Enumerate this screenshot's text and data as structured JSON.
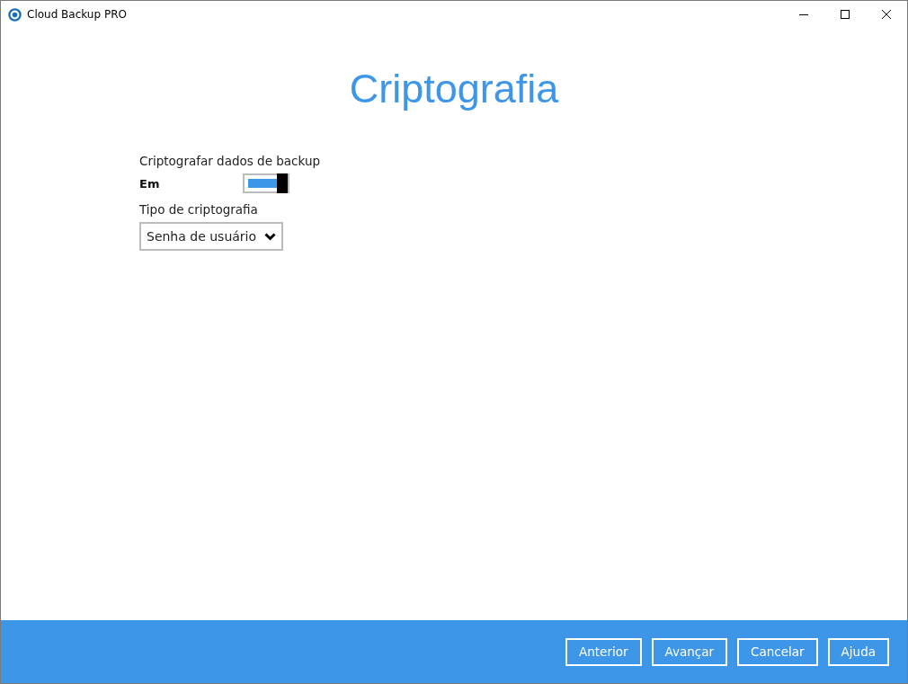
{
  "window": {
    "title": "Cloud Backup PRO"
  },
  "page": {
    "heading": "Criptografia"
  },
  "encrypt": {
    "label": "Criptografar dados de backup",
    "state_text": "Em",
    "on": true
  },
  "encryption_type": {
    "label": "Tipo de criptografia",
    "value": "Senha de usuário"
  },
  "buttons": [
    {
      "label": "Anterior"
    },
    {
      "label": "Avançar"
    },
    {
      "label": "Cancelar"
    },
    {
      "label": "Ajuda"
    }
  ]
}
